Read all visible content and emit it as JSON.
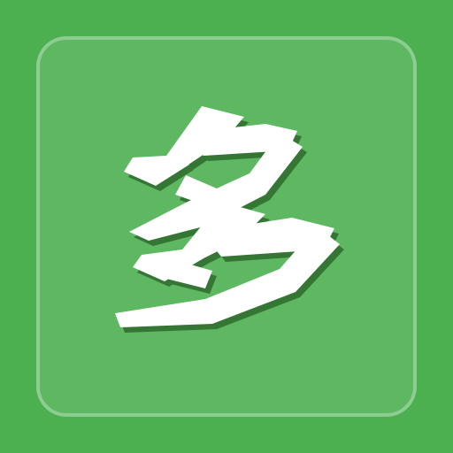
{
  "icon": {
    "character": "多",
    "colors": {
      "background": "#4caf50",
      "tile_fill": "rgba(255,255,255,0.1)",
      "tile_border": "rgba(255,255,255,0.3)",
      "glyph": "#ffffff",
      "glyph_shadow": "#2e6b2e"
    }
  }
}
